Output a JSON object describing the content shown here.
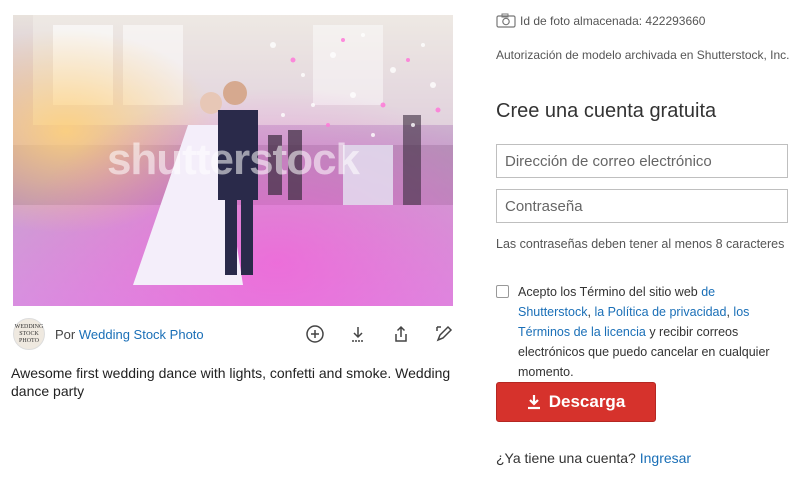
{
  "photo": {
    "watermark": "shutterstock",
    "alt_subject": "first wedding dance"
  },
  "contributor": {
    "avatar_text": "WEDDING STOCK PHOTO",
    "prefix": "Por",
    "name": "Wedding Stock Photo"
  },
  "toolbar": {
    "icons": [
      "add-to-collection-icon",
      "download-icon",
      "share-icon",
      "edit-icon"
    ]
  },
  "caption": "Awesome first wedding dance with lights, confetti and smoke. Wedding dance party",
  "meta": {
    "photo_id": "Id de foto almacenada: 422293660",
    "model_release": "Autorización de modelo archivada en Shutterstock, Inc."
  },
  "signup": {
    "heading": "Cree una cuenta gratuita",
    "email_placeholder": "Dirección de correo electrónico",
    "password_placeholder": "Contraseña",
    "password_hint": "Las contraseñas deben tener al menos 8 caracteres",
    "terms_prefix": "Acepto los Término del sitio web ",
    "terms_link1": "de Shutterstock",
    "terms_sep1": ", ",
    "terms_link2": "la Política de privacidad",
    "terms_sep2": ", ",
    "terms_link3": "los Términos de la licencia",
    "terms_suffix": " y recibir correos electrónicos que puedo cancelar en cualquier momento.",
    "download_label": "Descarga",
    "login_prompt": "¿Ya tiene una cuenta?",
    "login_link": "Ingresar"
  },
  "colors": {
    "accent_red": "#d6322c",
    "link_blue": "#1a6fb7"
  }
}
